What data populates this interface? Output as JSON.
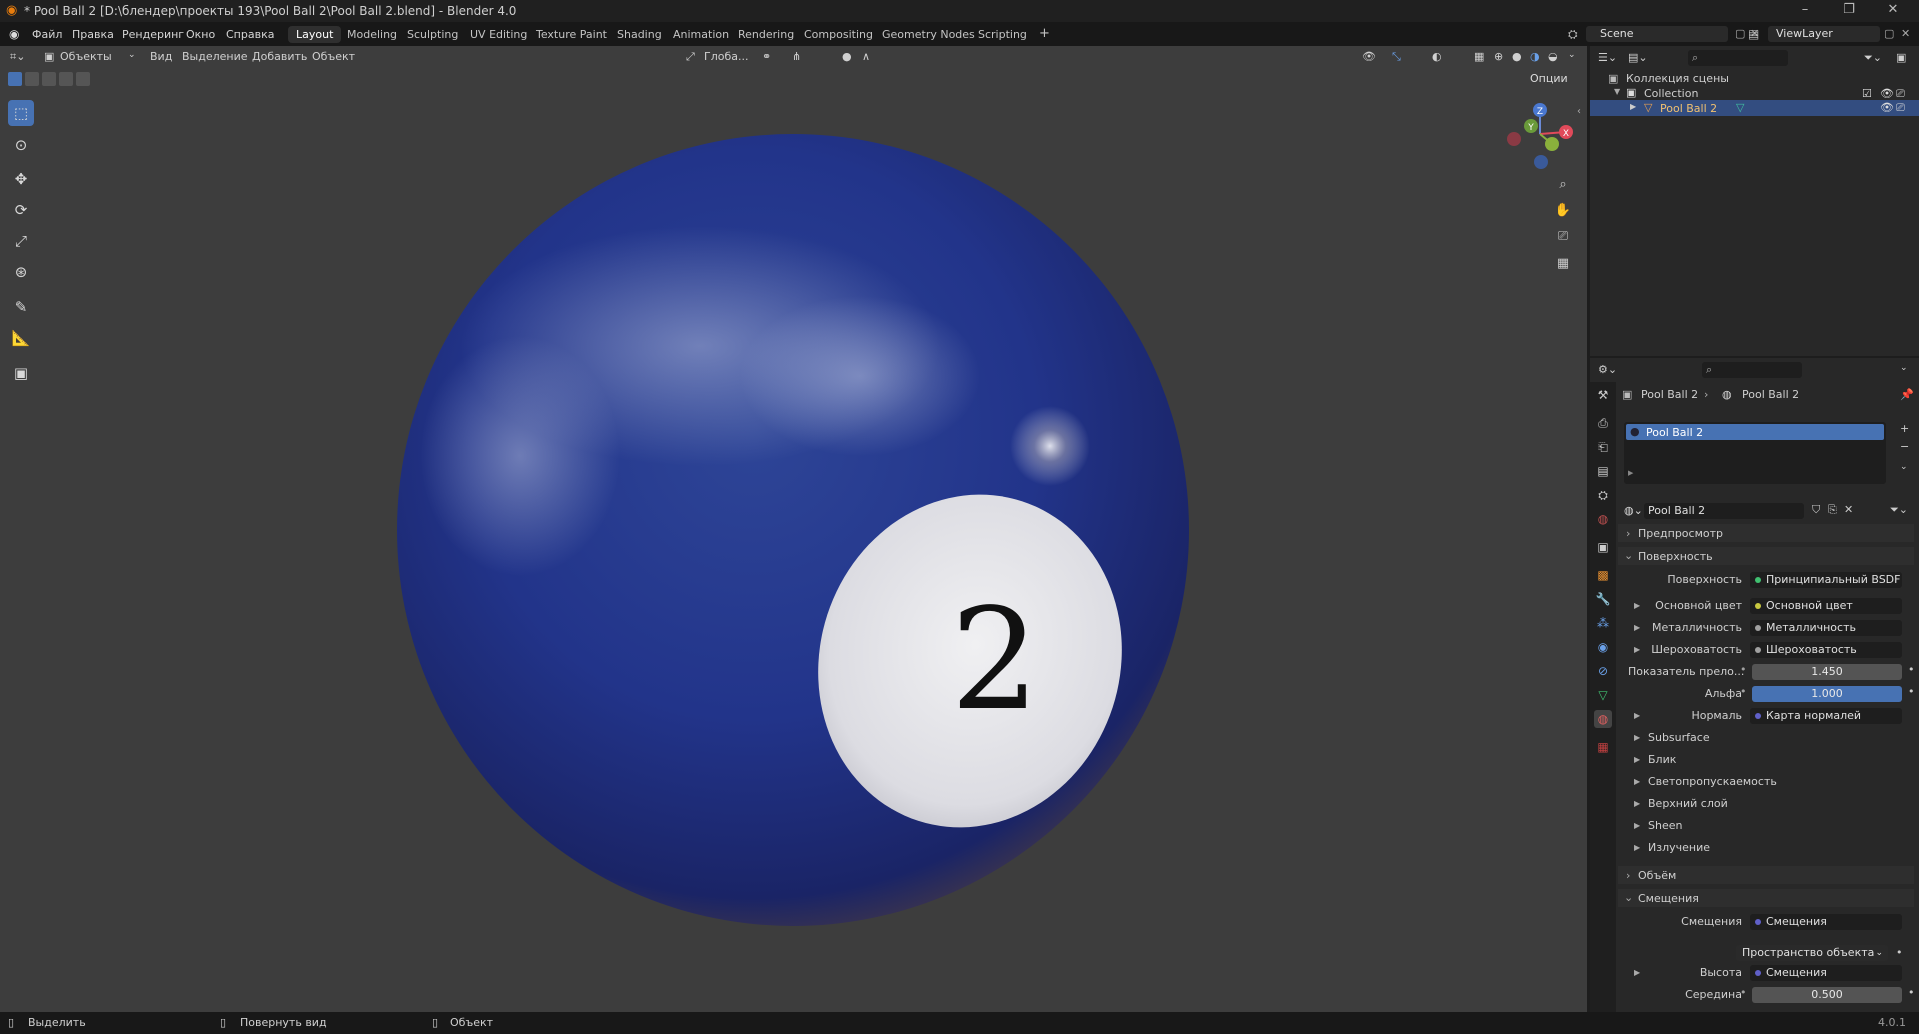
{
  "window": {
    "title": "* Pool Ball 2 [D:\\блендер\\проекты 193\\Pool Ball 2\\Pool Ball 2.blend] - Blender 4.0"
  },
  "menu": [
    "Файл",
    "Правка",
    "Рендеринг",
    "Окно",
    "Справка"
  ],
  "workspaces": [
    "Layout",
    "Modeling",
    "Sculpting",
    "UV Editing",
    "Texture Paint",
    "Shading",
    "Animation",
    "Rendering",
    "Compositing",
    "Geometry Nodes",
    "Scripting"
  ],
  "active_workspace": "Layout",
  "scene": {
    "name": "Scene",
    "view_layer": "ViewLayer"
  },
  "viewport_header": {
    "mode": "Объекты",
    "menus": [
      "Вид",
      "Выделение",
      "Добавить",
      "Объект"
    ],
    "orientation": "Глоба...",
    "options": "Опции"
  },
  "viewport": {
    "ball_number": "2"
  },
  "outliner": {
    "root": "Коллекция сцены",
    "collection": "Collection",
    "object": "Pool Ball 2"
  },
  "properties": {
    "breadcrumb": [
      "Pool Ball 2",
      "Pool Ball 2"
    ],
    "material_slot": "Pool Ball 2",
    "material_name": "Pool Ball 2",
    "panels": {
      "preview": "Предпросмотр",
      "surface": "Поверхность",
      "volume": "Объём",
      "displacement": "Смещения"
    },
    "surface": {
      "label": "Поверхность",
      "value": "Принципиальный BSDF"
    },
    "inputs": [
      {
        "label": "Основной цвет",
        "value": "Основной цвет",
        "expandable": true
      },
      {
        "label": "Металличность",
        "value": "Металличность",
        "expandable": true
      },
      {
        "label": "Шероховатость",
        "value": "Шероховатость",
        "expandable": true
      },
      {
        "label": "Показатель прело...",
        "value": "1.450",
        "numeric": true
      },
      {
        "label": "Альфа",
        "value": "1.000",
        "numeric": true,
        "highlight": true
      },
      {
        "label": "Нормаль",
        "value": "Карта нормалей",
        "expandable": true
      }
    ],
    "subpanels": [
      "Subsurface",
      "Блик",
      "Светопропускаемость",
      "Верхний слой",
      "Sheen",
      "Излучение"
    ],
    "displacement": {
      "label": "Смещения",
      "value": "Смещения",
      "space": "Пространство объекта",
      "height_label": "Высота",
      "height_value": "Смещения",
      "mid_label": "Середина",
      "mid_value": "0.500"
    }
  },
  "statusbar": {
    "select": "Выделить",
    "rotate": "Повернуть вид",
    "object": "Объект",
    "version": "4.0.1"
  }
}
